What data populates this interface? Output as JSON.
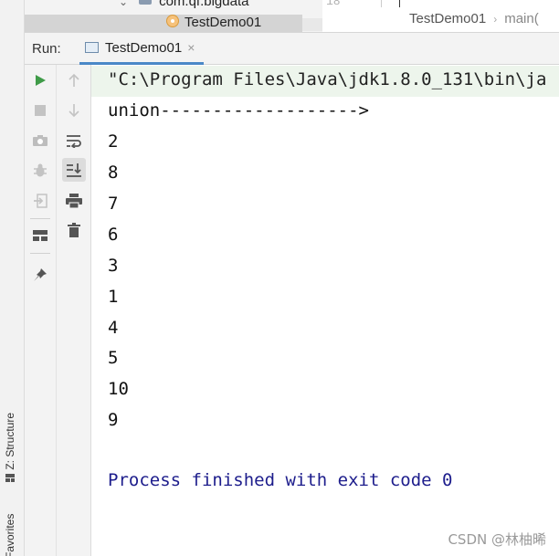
{
  "left_strip": {
    "structure_label": "Z: Structure",
    "favorites_label": "Favorites"
  },
  "project_tree": {
    "package_label": "com.qf.bigdata",
    "class_label": "TestDemo01"
  },
  "editor": {
    "gutter_line_number": "18",
    "breadcrumb_class": "TestDemo01",
    "breadcrumb_method": "main("
  },
  "run_window": {
    "label": "Run:",
    "tab_label": "TestDemo01",
    "close_glyph": "×"
  },
  "console": {
    "command_line": "\"C:\\Program Files\\Java\\jdk1.8.0_131\\bin\\ja",
    "header_line": "union------------------->",
    "outputs": [
      "2",
      "8",
      "7",
      "6",
      "3",
      "1",
      "4",
      "5",
      "10",
      "9"
    ],
    "finished_line": "Process finished with exit code 0"
  },
  "toolbar": {
    "col1": [
      "run-icon",
      "stop-icon",
      "camera-icon",
      "debug-bug-icon",
      "exit-icon",
      "layout-icon",
      "pin-icon"
    ],
    "col2": [
      "up-arrow-icon",
      "down-arrow-icon",
      "soft-wrap-icon",
      "scroll-to-end-icon",
      "print-icon",
      "trash-icon"
    ]
  },
  "watermark": "CSDN @林柚晞",
  "colors": {
    "run_green": "#3f9b48",
    "finished_text": "#1d1d8c",
    "command_bg": "#edf5ec",
    "tab_underline": "#4a88c7"
  }
}
